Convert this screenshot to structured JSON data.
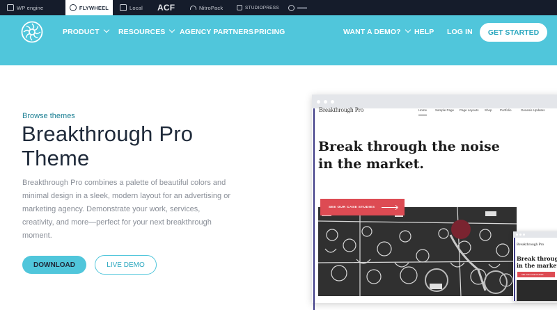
{
  "brandbar": {
    "items": [
      {
        "label": "WP engine",
        "icon": "wpengine-grid-icon"
      },
      {
        "label": "FLYWHEEL",
        "icon": "flywheel-icon",
        "active": true
      },
      {
        "label": "Local",
        "icon": "local-icon"
      },
      {
        "label": "ACF",
        "icon": "acf-logo"
      },
      {
        "label": "NitroPack",
        "icon": "nitropack-icon"
      },
      {
        "label": "STUDIOPRESS",
        "icon": "studiopress-icon"
      }
    ]
  },
  "nav": {
    "logo": "flywheel-logo-icon",
    "product": "PRODUCT",
    "resources": "RESOURCES",
    "agency": "AGENCY PARTNERS",
    "pricing": "PRICING",
    "demo": "WANT A DEMO?",
    "help": "HELP",
    "login": "LOG IN",
    "cta": "GET STARTED"
  },
  "hero": {
    "breadcrumb": "Browse themes",
    "title_line1": "Breakthrough Pro",
    "title_line2": "Theme",
    "description": "Breakthrough Pro combines a palette of beautiful colors and minimal design in a sleek, modern layout for an advertising or marketing agency. Demonstrate your work, services, creativity, and more—perfect for your next breakthrough moment.",
    "download": "DOWNLOAD",
    "live_demo": "LIVE DEMO"
  },
  "preview": {
    "site_title": "Breakthrough Pro",
    "menu": [
      "Home",
      "Sample Page",
      "Page Layouts",
      "Shop",
      "Portfolio",
      "Genesis Updates"
    ],
    "headline_line1": "Break through the noise",
    "headline_line2": "in the market.",
    "cta": "SEE OUR CASE STUDIES"
  },
  "preview_small": {
    "site_title": "Breakthrough Pro",
    "headline_line1": "Break through t",
    "headline_line2": "in the market.",
    "cta": "SEE OUR CASE STUDIES"
  },
  "colors": {
    "nav_bg": "#50c6db",
    "brandbar_bg": "#151c2b",
    "accent_text": "#1b7f93",
    "preview_cta": "#dd4b53",
    "preview_rule": "#3d3a86"
  }
}
